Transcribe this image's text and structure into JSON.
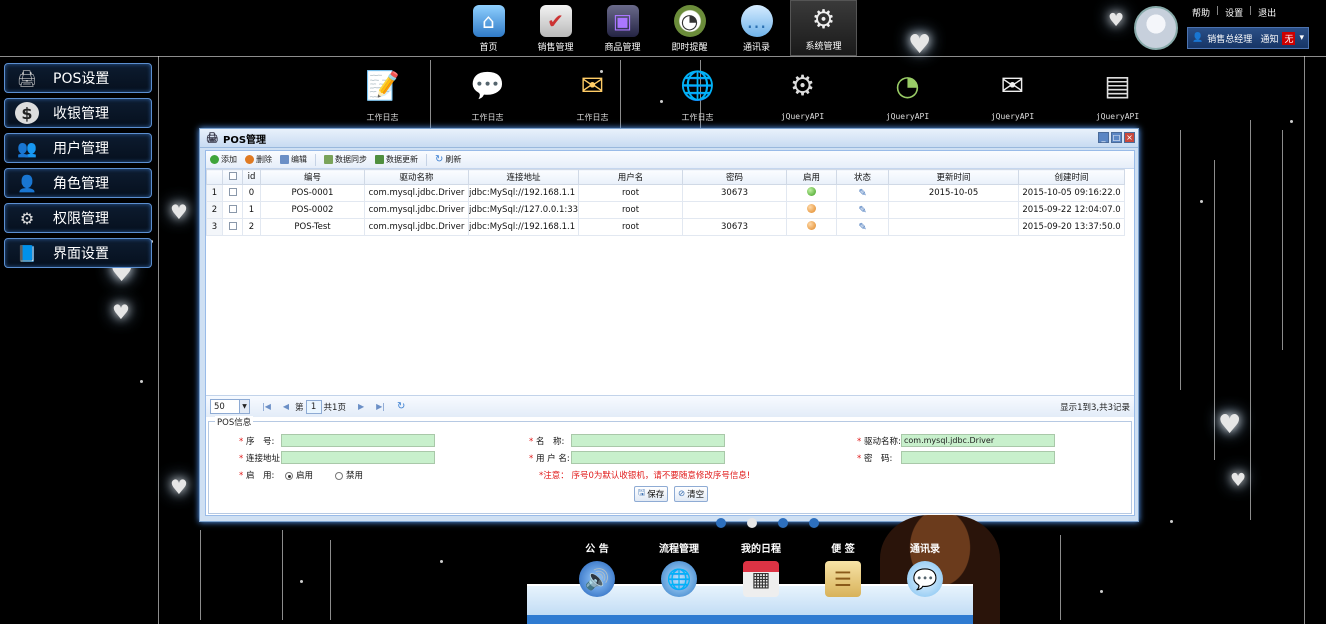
{
  "topnav": {
    "items": [
      {
        "label": "首页",
        "icon": "home-icon"
      },
      {
        "label": "销售管理",
        "icon": "clipboard-icon"
      },
      {
        "label": "商品管理",
        "icon": "monitor-icon"
      },
      {
        "label": "即时提醒",
        "icon": "clock-icon"
      },
      {
        "label": "通讯录",
        "icon": "chat-icon"
      },
      {
        "label": "系统管理",
        "icon": "gear-icon"
      }
    ]
  },
  "toplinks": {
    "help": "帮助",
    "settings": "设置",
    "logout": "退出"
  },
  "userbar": {
    "name": "销售总经理",
    "notice": "通知",
    "badge": "无"
  },
  "leftmenu": [
    {
      "label": "POS设置",
      "icon": "pos-icon"
    },
    {
      "label": "收银管理",
      "icon": "dollar-icon"
    },
    {
      "label": "用户管理",
      "icon": "users-icon"
    },
    {
      "label": "角色管理",
      "icon": "role-icon"
    },
    {
      "label": "权限管理",
      "icon": "permission-icon"
    },
    {
      "label": "界面设置",
      "icon": "book-icon"
    }
  ],
  "iconrow": [
    {
      "label": "工作日志",
      "icon": "notepad-icon"
    },
    {
      "label": "工作日志",
      "icon": "chat-icon"
    },
    {
      "label": "工作日志",
      "icon": "mail-icon"
    },
    {
      "label": "工作日志",
      "icon": "globe-icon"
    },
    {
      "label": "jQueryAPI",
      "icon": "gear-icon"
    },
    {
      "label": "jQueryAPI",
      "icon": "clock-icon"
    },
    {
      "label": "jQueryAPI",
      "icon": "envelope-icon"
    },
    {
      "label": "jQueryAPI",
      "icon": "document-icon"
    }
  ],
  "window": {
    "title": "POS管理"
  },
  "toolbar": {
    "add": "添加",
    "delete": "删除",
    "edit": "编辑",
    "sync": "数据同步",
    "update": "数据更新",
    "refresh": "刷新"
  },
  "table": {
    "headers": [
      "id",
      "编号",
      "驱动名称",
      "连接地址",
      "用户名",
      "密码",
      "启用",
      "状态",
      "更新时间",
      "创建时间"
    ],
    "rows": [
      {
        "rn": "1",
        "id": "0",
        "code": "POS-0001",
        "driver": "com.mysql.jdbc.Driver",
        "url": "jdbc:MySql://192.168.1.1",
        "user": "root",
        "pwd": "30673",
        "enabled": "on",
        "updated": "2015-10-05",
        "created": "2015-10-05 09:16:22.0"
      },
      {
        "rn": "2",
        "id": "1",
        "code": "POS-0002",
        "driver": "com.mysql.jdbc.Driver",
        "url": "jdbc:MySql://127.0.0.1:33",
        "user": "root",
        "pwd": "",
        "enabled": "off",
        "updated": "",
        "created": "2015-09-22 12:04:07.0"
      },
      {
        "rn": "3",
        "id": "2",
        "code": "POS-Test",
        "driver": "com.mysql.jdbc.Driver",
        "url": "jdbc:MySql://192.168.1.1",
        "user": "root",
        "pwd": "30673",
        "enabled": "off",
        "updated": "",
        "created": "2015-09-20 13:37:50.0"
      }
    ]
  },
  "pager": {
    "page_size": "50",
    "page_prefix": "第",
    "page": "1",
    "page_suffix": "共1页",
    "info": "显示1到3,共3记录"
  },
  "form": {
    "legend": "POS信息",
    "seq_label": "序　号:",
    "name_label": "名　称:",
    "driver_label": "驱动名称:",
    "driver_value": "com.mysql.jdbc.Driver",
    "url_label": "连接地址:",
    "user_label": "用 户 名:",
    "pwd_label": "密　码:",
    "enable_label": "启　用:",
    "enable_on": "启用",
    "enable_off": "禁用",
    "note": "*注意： 序号0为默认收银机，请不要随意修改序号信息!",
    "save": "保存",
    "clear": "清空"
  },
  "dock": [
    {
      "label": "公 告",
      "icon": "speaker-icon"
    },
    {
      "label": "流程管理",
      "icon": "globe-icon"
    },
    {
      "label": "我的日程",
      "icon": "calendar-icon"
    },
    {
      "label": "便 签",
      "icon": "notepad-icon"
    },
    {
      "label": "通讯录",
      "icon": "chat-icon"
    }
  ]
}
